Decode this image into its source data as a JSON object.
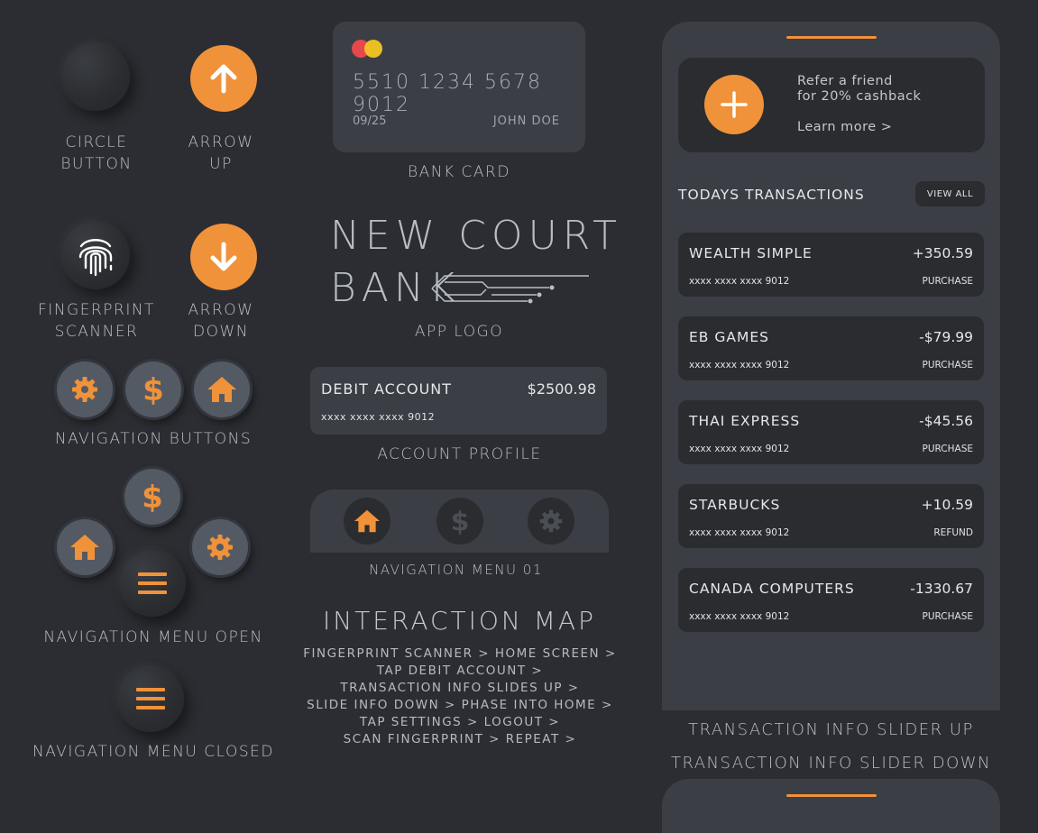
{
  "colors": {
    "accent": "#f0923a",
    "background": "#2b2d32",
    "surface": "#3b3e44",
    "surface_dark": "#2a2c30"
  },
  "left": {
    "circle_button_label": [
      "Circle",
      "Button"
    ],
    "arrow_up_label": [
      "Arrow",
      "Up"
    ],
    "fingerprint_label": [
      "Fingerprint",
      "Scanner"
    ],
    "arrow_down_label": [
      "Arrow",
      "Down"
    ],
    "nav_buttons_label": "Navigation Buttons",
    "nav_menu_open_label": "Navigation Menu Open",
    "nav_menu_closed_label": "Navigation Menu Closed",
    "icons": [
      "arrow-up-icon",
      "arrow-down-icon",
      "fingerprint-icon",
      "gear-icon",
      "dollar-icon",
      "home-icon",
      "hamburger-icon"
    ]
  },
  "card": {
    "number": "5510 1234 5678 9012",
    "expiry": "09/25",
    "holder": "JOHN DOE",
    "caption": "Bank Card"
  },
  "logo": {
    "line1": "New Court",
    "line2": "Bank",
    "caption": "App Logo"
  },
  "account": {
    "title": "Debit Account",
    "amount": "$2500.98",
    "number": "xxxx xxxx xxxx 9012",
    "caption": "Account Profile"
  },
  "nav_menu": {
    "caption": "Navigation Menu 01"
  },
  "interaction_map": {
    "title": "Interaction Map",
    "lines": [
      "Fingerprint Scanner > Home Screen >",
      "Tap Debit Account >",
      "Transaction Info Slides up >",
      "Slide info down > Phase into home >",
      "Tap Settings > Logout >",
      "Scan Fingerprint > Repeat >"
    ]
  },
  "panel": {
    "refer_line1": "Refer a friend",
    "refer_line2": "for 20% cashback",
    "learn_more": "Learn more >",
    "transactions_title": "Todays Transactions",
    "view_all": "View all",
    "transactions": [
      {
        "name": "Wealth Simple",
        "amount": "+350.59",
        "number": "xxxx xxxx xxxx 9012",
        "type": "Purchase"
      },
      {
        "name": "EB Games",
        "amount": "-$79.99",
        "number": "xxxx xxxx xxxx 9012",
        "type": "Purchase"
      },
      {
        "name": "Thai Express",
        "amount": "-$45.56",
        "number": "xxxx xxxx xxxx 9012",
        "type": "Purchase"
      },
      {
        "name": "Starbucks",
        "amount": "+10.59",
        "number": "xxxx xxxx xxxx 9012",
        "type": "Refund"
      },
      {
        "name": "Canada Computers",
        "amount": "-1330.67",
        "number": "xxxx xxxx xxxx 9012",
        "type": "Purchase"
      }
    ],
    "slider_up_caption": "Transaction Info Slider Up",
    "slider_down_caption": "Transaction Info Slider Down"
  }
}
